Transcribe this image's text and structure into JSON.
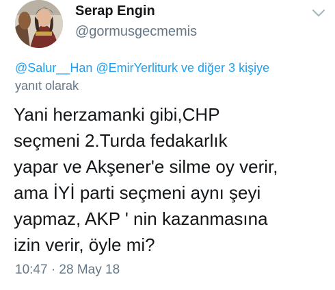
{
  "author": {
    "display_name": "Serap Engin",
    "handle": "@gormusgecmemis"
  },
  "reply_context": {
    "mention_1": "@Salur__Han",
    "mention_2": "@EmirYerliturk",
    "others": "ve diğer 3 kişiye",
    "suffix": "yanıt olarak"
  },
  "tweet_lines": [
    "Yani herzamanki gibi,CHP",
    "seçmeni 2.Turda fedakarlık",
    "yapar ve Akşener'e silme oy verir,",
    "ama İYİ parti seçmeni aynı şeyi",
    "yapmaz, AKP ' nin kazanmasına",
    "izin verir, öyle mi?"
  ],
  "timestamp": "10:47 · 28 May 18",
  "icons": {
    "avatar": "profile-photo",
    "menu": "chevron-down-icon"
  },
  "colors": {
    "link": "#1da1f2",
    "secondary": "#657786",
    "text": "#14171a"
  }
}
